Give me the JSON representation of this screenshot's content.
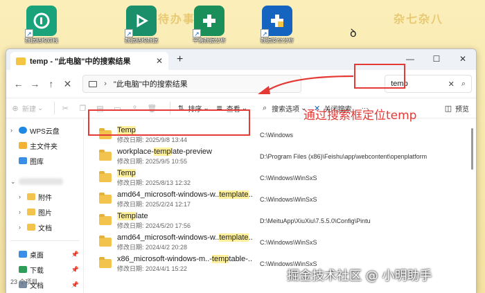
{
  "desktop": {
    "deco_left": "待办事",
    "deco_right": "杂七杂八",
    "icons": [
      {
        "label": "数据结构双栈",
        "color": "#1aa37a"
      },
      {
        "label": "数据结构数据",
        "color": "#1a8f6a"
      },
      {
        "label": "平衡数据分析",
        "color": "#1b8f5a"
      },
      {
        "label": "数据安全分析",
        "color": "#1565c0"
      }
    ]
  },
  "window": {
    "tab_title": "temp - \"此电脑\"中的搜索结果",
    "address": "\"此电脑\"中的搜索结果",
    "search_value": "temp"
  },
  "toolbar": {
    "new": "新建",
    "sort": "排序",
    "view": "查看",
    "search_options": "搜索选项",
    "close_search": "关闭搜索",
    "more": "···",
    "preview": "预览"
  },
  "sidebar": {
    "items": [
      {
        "label": "WPS云盘",
        "color": "#1e88e5"
      },
      {
        "label": "主文件夹",
        "color": "#f2b233"
      },
      {
        "label": "图库",
        "color": "#3a8ee6"
      }
    ],
    "folders": [
      {
        "label": "附件"
      },
      {
        "label": "图片"
      },
      {
        "label": "文档"
      }
    ],
    "quick": [
      {
        "label": "桌面",
        "color": "#3a8ee6"
      },
      {
        "label": "下载",
        "color": "#2e9d5a"
      },
      {
        "label": "文档",
        "color": "#7a8aa0"
      }
    ],
    "status": "23 个项目"
  },
  "files": [
    {
      "pre": "",
      "hl": "Temp",
      "post": "",
      "date": "修改日期: 2025/9/8 13:44",
      "path": "C:\\Windows"
    },
    {
      "pre": "workplace-",
      "hl": "temp",
      "post": "late-preview",
      "date": "修改日期: 2025/9/5 10:55",
      "path": "D:\\Program Files (x86)\\Feishu\\app\\webcontent\\openplatform"
    },
    {
      "pre": "",
      "hl": "Temp",
      "post": "",
      "date": "修改日期: 2025/8/13 12:32",
      "path": "C:\\Windows\\WinSxS"
    },
    {
      "pre": "amd64_microsoft-windows-w..",
      "hl": "template",
      "post": "...",
      "date": "修改日期: 2025/2/24 12:17",
      "path": "C:\\Windows\\WinSxS"
    },
    {
      "pre": "",
      "hl": "Temp",
      "post": "late",
      "date": "修改日期: 2024/5/20 17:56",
      "path": "D:\\MeituApp\\XiuXiu\\7.5.5.0\\Config\\Pintu"
    },
    {
      "pre": "amd64_microsoft-windows-w..",
      "hl": "template",
      "post": "...",
      "date": "修改日期: 2024/4/2 20:28",
      "path": "C:\\Windows\\WinSxS"
    },
    {
      "pre": "x86_microsoft-windows-m..-",
      "hl": "temp",
      "post": "table-...",
      "date": "修改日期: 2024/4/1 15:22",
      "path": "C:\\Windows\\WinSxS"
    }
  ],
  "annotation": "通过搜索框定位temp",
  "watermark": "掘金技术社区 @ 小明助手",
  "colors": {
    "annotation_red": "#e53935",
    "highlight": "#fff19c",
    "folder": "#f2c44d"
  }
}
